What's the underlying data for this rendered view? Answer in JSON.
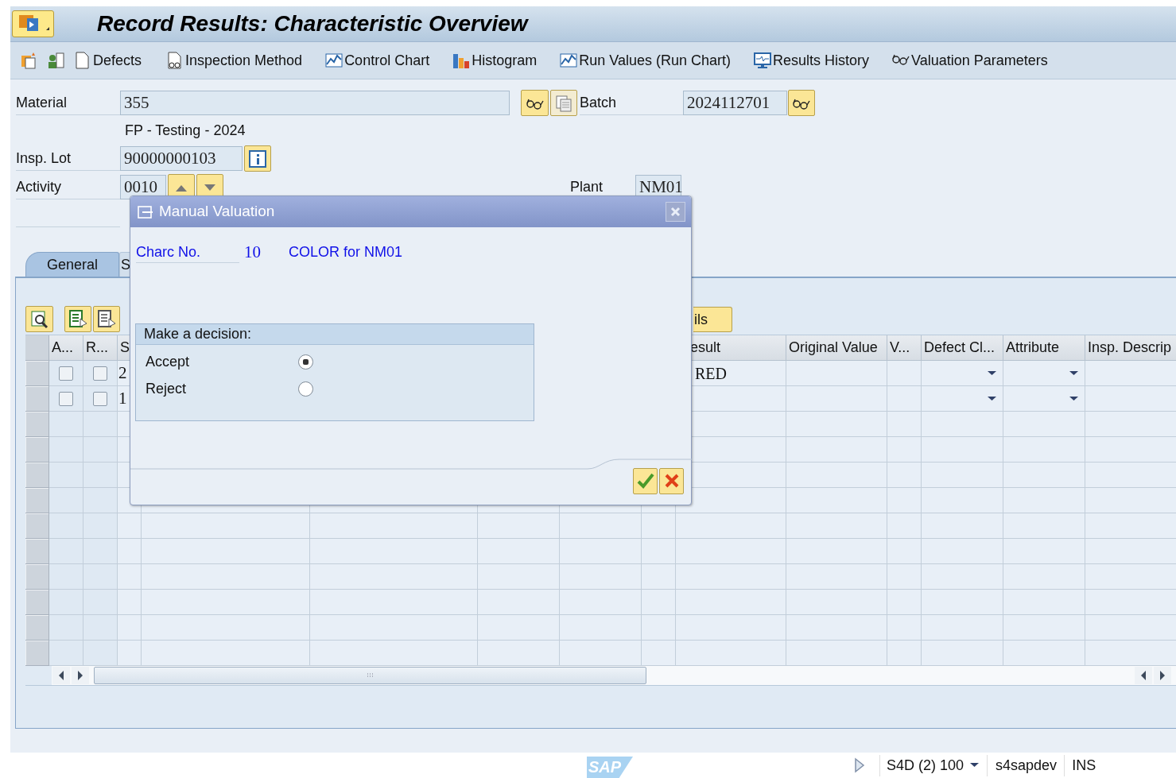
{
  "window": {
    "title": "Record Results: Characteristic Overview"
  },
  "toolbar": [
    "Defects",
    "Inspection Method",
    "Control Chart",
    "Histogram",
    "Run Values (Run Chart)",
    "Results History",
    "Valuation Parameters"
  ],
  "header": {
    "material_label": "Material",
    "material": "355",
    "batch_label": "Batch",
    "batch": "2024112701",
    "material_description": "FP - Testing - 2024",
    "insp_lot_label": "Insp. Lot",
    "insp_lot": "90000000103",
    "activity_label": "Activity",
    "activity": "0010",
    "plant_label": "Plant",
    "plant": "NM01"
  },
  "tabs": [
    {
      "label": "General",
      "selected": true
    },
    {
      "label": "S",
      "selected": false
    }
  ],
  "details_button": "ils",
  "table": {
    "columns": [
      "A...",
      "R...",
      "S",
      "esult",
      "Original Value",
      "V...",
      "Defect Cl...",
      "Attribute",
      "Insp. Descrip"
    ],
    "rows": [
      {
        "a_checked": false,
        "r_checked": false,
        "column_3": "2",
        "result": "RED"
      },
      {
        "a_checked": false,
        "r_checked": false,
        "column_3": "1"
      }
    ]
  },
  "dialog": {
    "title": "Manual Valuation",
    "charc_label": "Charc No.",
    "charc_no": "10",
    "charc_text": "COLOR for NM01",
    "group_title": "Make a decision:",
    "options": [
      {
        "label": "Accept",
        "selected": true
      },
      {
        "label": "Reject",
        "selected": false
      }
    ]
  },
  "status_bar": {
    "logo": "SAP",
    "system": "S4D (2) 100",
    "user": "s4sapdev",
    "mode": "INS"
  }
}
